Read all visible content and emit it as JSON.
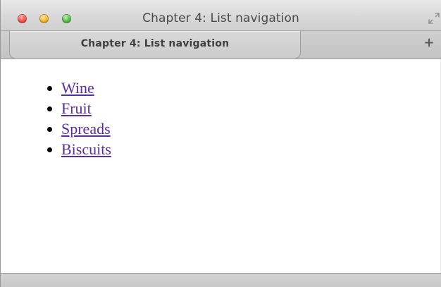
{
  "window": {
    "title": "Chapter 4: List navigation"
  },
  "tabs": [
    {
      "label": "Chapter 4: List navigation"
    }
  ],
  "toolbar": {
    "new_tab_label": "+"
  },
  "icons": {
    "close": "close-window-icon",
    "minimize": "minimize-window-icon",
    "zoom": "zoom-window-icon",
    "fullscreen": "fullscreen-icon"
  },
  "colors": {
    "link": "#5a2da6",
    "close": "#ff5f57",
    "minimize": "#ffbd2e",
    "zoom": "#61c554"
  },
  "content": {
    "nav_items": [
      {
        "label": "Wine"
      },
      {
        "label": "Fruit"
      },
      {
        "label": "Spreads"
      },
      {
        "label": "Biscuits"
      }
    ]
  }
}
